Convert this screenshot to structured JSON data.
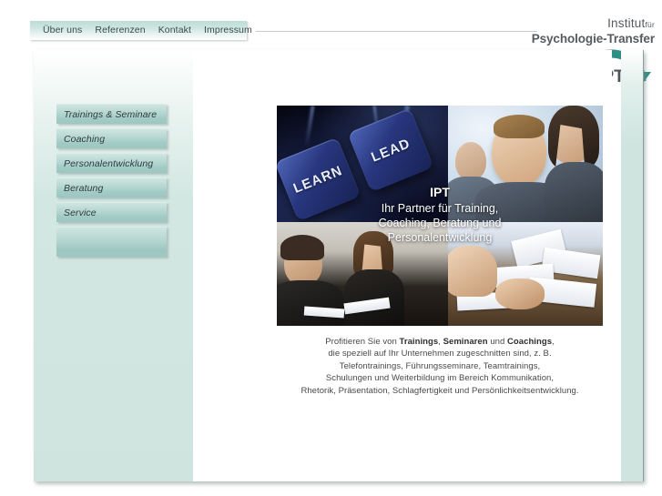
{
  "topnav": {
    "items": [
      {
        "label": "Über uns"
      },
      {
        "label": "Referenzen"
      },
      {
        "label": "Kontakt"
      },
      {
        "label": "Impressum"
      }
    ]
  },
  "logo": {
    "line1_main": "Institut",
    "line1_small": "für",
    "line2": "Psychologie-Transfer",
    "mark_text": "IPT",
    "arc_left_color": "#8d9499",
    "arc_right_color": "#2f8f86",
    "text_color": "#555b5e"
  },
  "sidebar": {
    "items": [
      {
        "label": "Trainings & Seminare"
      },
      {
        "label": "Coaching"
      },
      {
        "label": "Personalentwicklung"
      },
      {
        "label": "Beratung"
      },
      {
        "label": "Service"
      },
      {
        "label": ""
      }
    ],
    "background_color": "#cfe4df"
  },
  "banner": {
    "caption_title": "IPT",
    "caption_lines": [
      "Ihr Partner für Training,",
      "Coaching, Beratung und",
      "Personalentwicklung"
    ],
    "tiles": {
      "top_left_alt": "Blaue Tastaturtasten mit LEARN und LEAD",
      "key1_text": "LEARN",
      "key2_text": "LEAD",
      "top_right_alt": "Lächelnde Geschäftsleute",
      "bottom_left_alt": "Besprechung zweier Personen",
      "bottom_right_alt": "Schreibtisch mit Unterlagen"
    }
  },
  "intro": {
    "lines": [
      {
        "parts": [
          {
            "t": "Profitieren Sie von ",
            "b": false
          },
          {
            "t": "Trainings",
            "b": true
          },
          {
            "t": ", ",
            "b": false
          },
          {
            "t": "Seminaren",
            "b": true
          },
          {
            "t": " und ",
            "b": false
          },
          {
            "t": "Coachings",
            "b": true
          },
          {
            "t": ",",
            "b": false
          }
        ]
      },
      {
        "parts": [
          {
            "t": "die speziell auf Ihr Unternehmen zugeschnitten sind, z. B.",
            "b": false
          }
        ]
      },
      {
        "parts": [
          {
            "t": "Telefontrainings, Führungsseminare, Teamtrainings,",
            "b": false
          }
        ]
      },
      {
        "parts": [
          {
            "t": "Schulungen und Weiterbildung im Bereich Kommunikation,",
            "b": false
          }
        ]
      },
      {
        "parts": [
          {
            "t": "Rhetorik, Präsentation, Schlagfertigkeit und Persönlichkeitsentwicklung.",
            "b": false
          }
        ]
      }
    ]
  },
  "theme": {
    "page_background": "#ffffff",
    "panel_teal": "#cfe4df",
    "button_teal": "#a3cbc5",
    "body_text": "#4a4a4a"
  }
}
